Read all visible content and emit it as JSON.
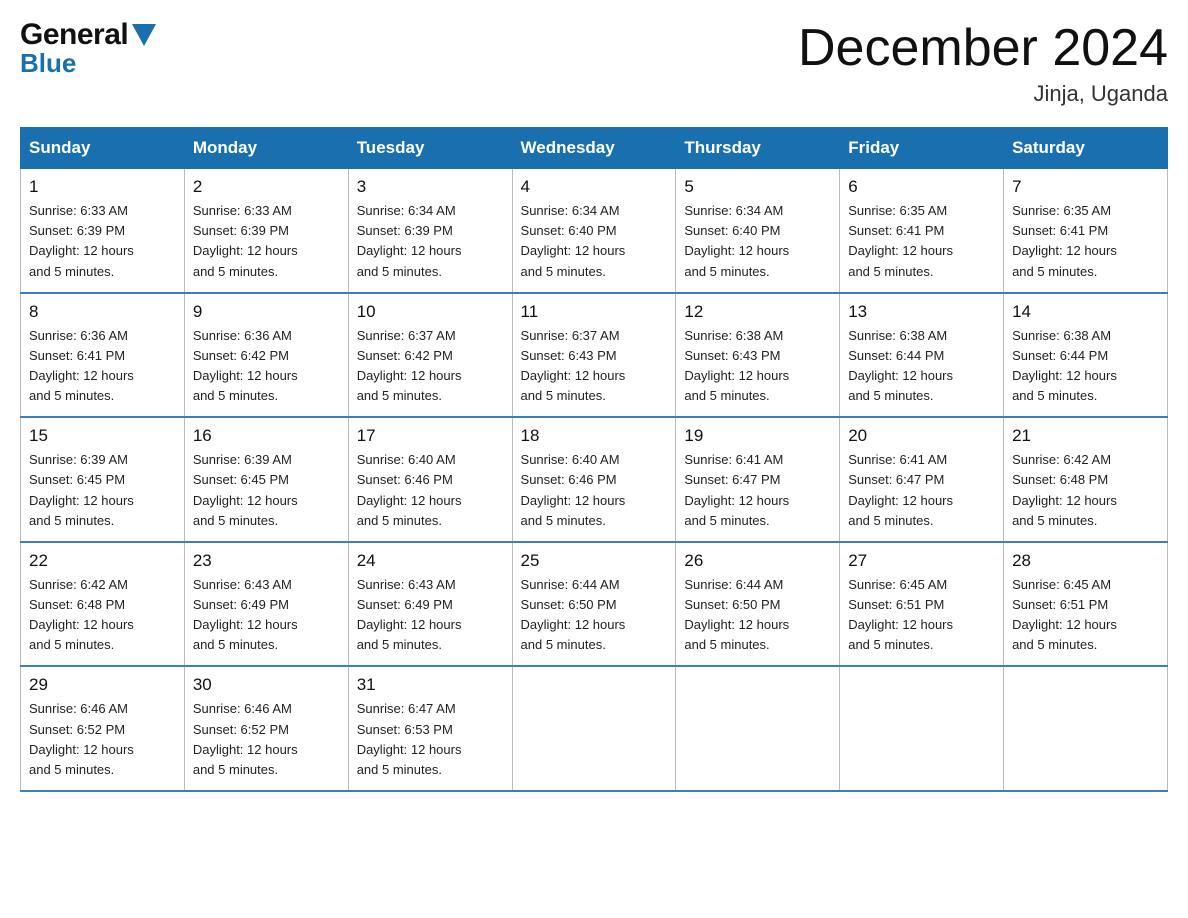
{
  "header": {
    "logo_general": "General",
    "logo_blue": "Blue",
    "month_title": "December 2024",
    "location": "Jinja, Uganda"
  },
  "calendar": {
    "days_of_week": [
      "Sunday",
      "Monday",
      "Tuesday",
      "Wednesday",
      "Thursday",
      "Friday",
      "Saturday"
    ],
    "weeks": [
      [
        {
          "day": "1",
          "sunrise": "6:33 AM",
          "sunset": "6:39 PM",
          "daylight": "12 hours and 5 minutes."
        },
        {
          "day": "2",
          "sunrise": "6:33 AM",
          "sunset": "6:39 PM",
          "daylight": "12 hours and 5 minutes."
        },
        {
          "day": "3",
          "sunrise": "6:34 AM",
          "sunset": "6:39 PM",
          "daylight": "12 hours and 5 minutes."
        },
        {
          "day": "4",
          "sunrise": "6:34 AM",
          "sunset": "6:40 PM",
          "daylight": "12 hours and 5 minutes."
        },
        {
          "day": "5",
          "sunrise": "6:34 AM",
          "sunset": "6:40 PM",
          "daylight": "12 hours and 5 minutes."
        },
        {
          "day": "6",
          "sunrise": "6:35 AM",
          "sunset": "6:41 PM",
          "daylight": "12 hours and 5 minutes."
        },
        {
          "day": "7",
          "sunrise": "6:35 AM",
          "sunset": "6:41 PM",
          "daylight": "12 hours and 5 minutes."
        }
      ],
      [
        {
          "day": "8",
          "sunrise": "6:36 AM",
          "sunset": "6:41 PM",
          "daylight": "12 hours and 5 minutes."
        },
        {
          "day": "9",
          "sunrise": "6:36 AM",
          "sunset": "6:42 PM",
          "daylight": "12 hours and 5 minutes."
        },
        {
          "day": "10",
          "sunrise": "6:37 AM",
          "sunset": "6:42 PM",
          "daylight": "12 hours and 5 minutes."
        },
        {
          "day": "11",
          "sunrise": "6:37 AM",
          "sunset": "6:43 PM",
          "daylight": "12 hours and 5 minutes."
        },
        {
          "day": "12",
          "sunrise": "6:38 AM",
          "sunset": "6:43 PM",
          "daylight": "12 hours and 5 minutes."
        },
        {
          "day": "13",
          "sunrise": "6:38 AM",
          "sunset": "6:44 PM",
          "daylight": "12 hours and 5 minutes."
        },
        {
          "day": "14",
          "sunrise": "6:38 AM",
          "sunset": "6:44 PM",
          "daylight": "12 hours and 5 minutes."
        }
      ],
      [
        {
          "day": "15",
          "sunrise": "6:39 AM",
          "sunset": "6:45 PM",
          "daylight": "12 hours and 5 minutes."
        },
        {
          "day": "16",
          "sunrise": "6:39 AM",
          "sunset": "6:45 PM",
          "daylight": "12 hours and 5 minutes."
        },
        {
          "day": "17",
          "sunrise": "6:40 AM",
          "sunset": "6:46 PM",
          "daylight": "12 hours and 5 minutes."
        },
        {
          "day": "18",
          "sunrise": "6:40 AM",
          "sunset": "6:46 PM",
          "daylight": "12 hours and 5 minutes."
        },
        {
          "day": "19",
          "sunrise": "6:41 AM",
          "sunset": "6:47 PM",
          "daylight": "12 hours and 5 minutes."
        },
        {
          "day": "20",
          "sunrise": "6:41 AM",
          "sunset": "6:47 PM",
          "daylight": "12 hours and 5 minutes."
        },
        {
          "day": "21",
          "sunrise": "6:42 AM",
          "sunset": "6:48 PM",
          "daylight": "12 hours and 5 minutes."
        }
      ],
      [
        {
          "day": "22",
          "sunrise": "6:42 AM",
          "sunset": "6:48 PM",
          "daylight": "12 hours and 5 minutes."
        },
        {
          "day": "23",
          "sunrise": "6:43 AM",
          "sunset": "6:49 PM",
          "daylight": "12 hours and 5 minutes."
        },
        {
          "day": "24",
          "sunrise": "6:43 AM",
          "sunset": "6:49 PM",
          "daylight": "12 hours and 5 minutes."
        },
        {
          "day": "25",
          "sunrise": "6:44 AM",
          "sunset": "6:50 PM",
          "daylight": "12 hours and 5 minutes."
        },
        {
          "day": "26",
          "sunrise": "6:44 AM",
          "sunset": "6:50 PM",
          "daylight": "12 hours and 5 minutes."
        },
        {
          "day": "27",
          "sunrise": "6:45 AM",
          "sunset": "6:51 PM",
          "daylight": "12 hours and 5 minutes."
        },
        {
          "day": "28",
          "sunrise": "6:45 AM",
          "sunset": "6:51 PM",
          "daylight": "12 hours and 5 minutes."
        }
      ],
      [
        {
          "day": "29",
          "sunrise": "6:46 AM",
          "sunset": "6:52 PM",
          "daylight": "12 hours and 5 minutes."
        },
        {
          "day": "30",
          "sunrise": "6:46 AM",
          "sunset": "6:52 PM",
          "daylight": "12 hours and 5 minutes."
        },
        {
          "day": "31",
          "sunrise": "6:47 AM",
          "sunset": "6:53 PM",
          "daylight": "12 hours and 5 minutes."
        },
        null,
        null,
        null,
        null
      ]
    ],
    "sunrise_label": "Sunrise:",
    "sunset_label": "Sunset:",
    "daylight_label": "Daylight:"
  }
}
